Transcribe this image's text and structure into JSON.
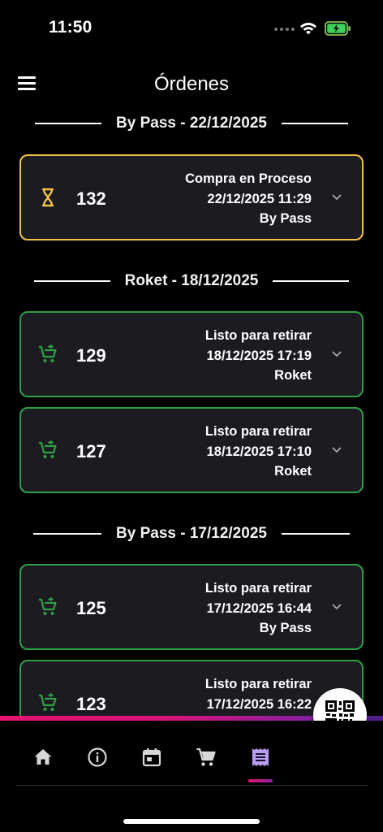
{
  "status_bar": {
    "time": "11:50"
  },
  "header": {
    "title": "Órdenes",
    "menu_icon": "menu-icon"
  },
  "sections": [
    {
      "label": "By Pass - 22/12/2025",
      "orders": [
        {
          "number": "132",
          "status": "Compra en Proceso",
          "datetime": "22/12/2025 11:29",
          "store": "By Pass",
          "icon": "hourglass-icon",
          "state": "pending"
        }
      ]
    },
    {
      "label": "Roket - 18/12/2025",
      "orders": [
        {
          "number": "129",
          "status": "Listo para retirar",
          "datetime": "18/12/2025 17:19",
          "store": "Roket",
          "icon": "cart-icon",
          "state": "ready"
        },
        {
          "number": "127",
          "status": "Listo para retirar",
          "datetime": "18/12/2025 17:10",
          "store": "Roket",
          "icon": "cart-icon",
          "state": "ready"
        }
      ]
    },
    {
      "label": "By Pass - 17/12/2025",
      "orders": [
        {
          "number": "125",
          "status": "Listo para retirar",
          "datetime": "17/12/2025 16:44",
          "store": "By Pass",
          "icon": "cart-icon",
          "state": "ready"
        },
        {
          "number": "123",
          "status": "Listo para retirar",
          "datetime": "17/12/2025 16:22",
          "store": "",
          "icon": "cart-icon",
          "state": "ready"
        }
      ]
    }
  ],
  "colors": {
    "pending_border": "#f3c244",
    "ready_border": "#2ea043",
    "card_bg": "#1b1b21",
    "accent_gradient_start": "#e6136f",
    "accent_gradient_end": "#4b1f8c",
    "active_nav": "#b89cf0"
  },
  "bottom_nav": {
    "items": [
      {
        "icon": "home-icon",
        "active": false
      },
      {
        "icon": "info-icon",
        "active": false
      },
      {
        "icon": "calendar-icon",
        "active": false
      },
      {
        "icon": "cart-icon",
        "active": false
      },
      {
        "icon": "receipt-icon",
        "active": true
      }
    ]
  },
  "fab": {
    "icon": "qr-code-icon"
  }
}
